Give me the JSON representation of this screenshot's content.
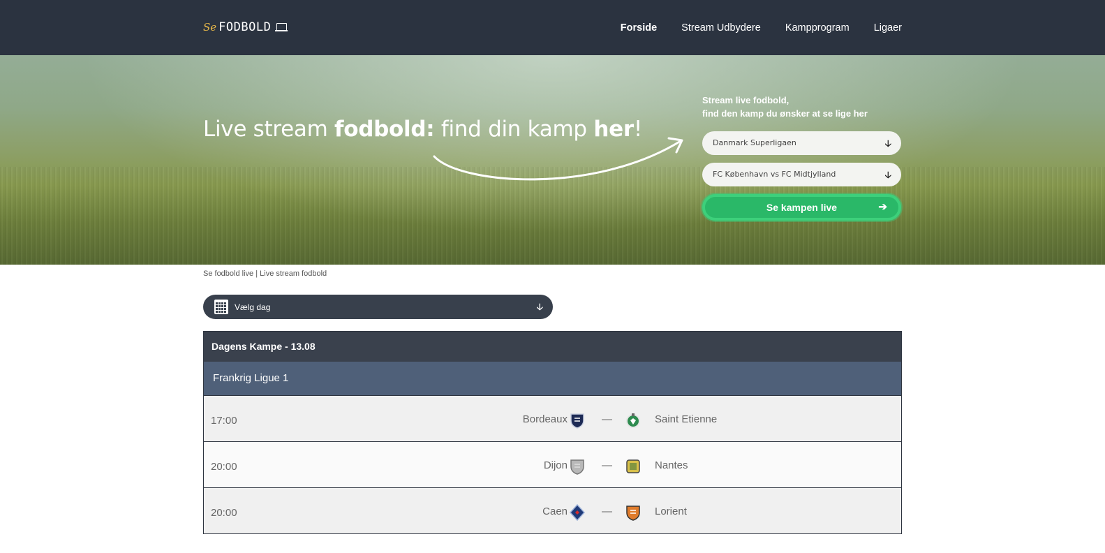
{
  "header": {
    "logo_prefix": "Se",
    "logo_brand": "FODBOLD",
    "nav": [
      {
        "label": "Forside",
        "active": true
      },
      {
        "label": "Stream Udbydere",
        "active": false
      },
      {
        "label": "Kampprogram",
        "active": false
      },
      {
        "label": "Ligaer",
        "active": false
      }
    ]
  },
  "hero": {
    "headline_part1": "Live stream ",
    "headline_bold1": "fodbold:",
    "headline_part2": " find din kamp ",
    "headline_bold2": "her",
    "headline_part3": "!",
    "form_lead_line1": "Stream live fodbold,",
    "form_lead_line2": "find den kamp du ønsker at se lige her",
    "league_select": "Danmark Superligaen",
    "match_select": "FC København vs FC Midtjylland",
    "cta_label": "Se kampen live"
  },
  "breadcrumb": "Se fodbold live | Live stream fodbold",
  "day_picker": {
    "label": "Vælg dag"
  },
  "matches_table": {
    "title": "Dagens Kampe - 13.08",
    "league": "Frankrig Ligue 1",
    "rows": [
      {
        "time": "17:00",
        "home": "Bordeaux",
        "away": "Saint Etienne",
        "home_icon": "bordeaux-crest-icon",
        "away_icon": "saint-etienne-crest-icon"
      },
      {
        "time": "20:00",
        "home": "Dijon",
        "away": "Nantes",
        "home_icon": "dijon-crest-icon",
        "away_icon": "nantes-crest-icon"
      },
      {
        "time": "20:00",
        "home": "Caen",
        "away": "Lorient",
        "home_icon": "caen-crest-icon",
        "away_icon": "lorient-crest-icon"
      }
    ],
    "separator": "—"
  },
  "colors": {
    "topbar": "#2b3340",
    "cta_green": "#2ab868",
    "league_bar": "#4f6079",
    "logo_accent": "#e9b949"
  }
}
